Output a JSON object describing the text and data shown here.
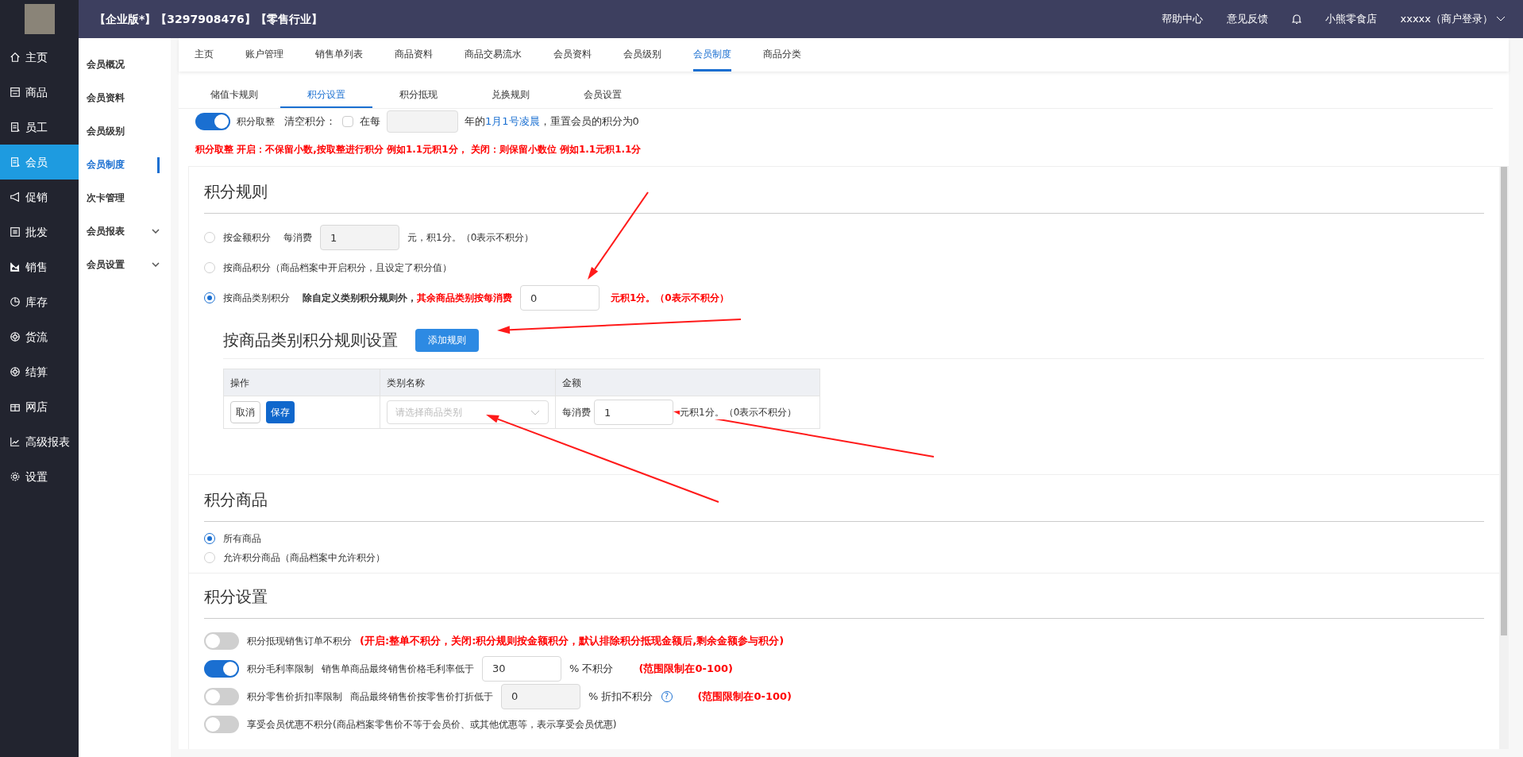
{
  "header": {
    "title": "【企业版*】【3297908476】【零售行业】",
    "links": [
      "帮助中心",
      "意见反馈"
    ],
    "store": "小熊零食店",
    "user": "xxxxx（商户登录）"
  },
  "sidebar": {
    "items": [
      {
        "label": "主页",
        "selected": false
      },
      {
        "label": "商品",
        "selected": false
      },
      {
        "label": "员工",
        "selected": false
      },
      {
        "label": "会员",
        "selected": true
      },
      {
        "label": "促销",
        "selected": false
      },
      {
        "label": "批发",
        "selected": false
      },
      {
        "label": "销售",
        "selected": false
      },
      {
        "label": "库存",
        "selected": false
      },
      {
        "label": "货流",
        "selected": false
      },
      {
        "label": "结算",
        "selected": false
      },
      {
        "label": "网店",
        "selected": false
      },
      {
        "label": "高级报表",
        "selected": false
      },
      {
        "label": "设置",
        "selected": false
      }
    ]
  },
  "submenu": [
    {
      "label": "会员概况",
      "selected": false,
      "expandable": false
    },
    {
      "label": "会员资料",
      "selected": false,
      "expandable": false
    },
    {
      "label": "会员级别",
      "selected": false,
      "expandable": false
    },
    {
      "label": "会员制度",
      "selected": true,
      "expandable": false
    },
    {
      "label": "次卡管理",
      "selected": false,
      "expandable": false
    },
    {
      "label": "会员报表",
      "selected": false,
      "expandable": true
    },
    {
      "label": "会员设置",
      "selected": false,
      "expandable": true
    }
  ],
  "top_tabs": [
    {
      "label": "主页",
      "selected": false
    },
    {
      "label": "账户管理",
      "selected": false
    },
    {
      "label": "销售单列表",
      "selected": false
    },
    {
      "label": "商品资料",
      "selected": false
    },
    {
      "label": "商品交易流水",
      "selected": false
    },
    {
      "label": "会员资料",
      "selected": false
    },
    {
      "label": "会员级别",
      "selected": false
    },
    {
      "label": "会员制度",
      "selected": true
    },
    {
      "label": "商品分类",
      "selected": false
    }
  ],
  "sub_tabs": [
    {
      "label": "储值卡规则",
      "selected": false
    },
    {
      "label": "积分设置",
      "selected": true
    },
    {
      "label": "积分抵现",
      "selected": false
    },
    {
      "label": "兑换规则",
      "selected": false
    },
    {
      "label": "会员设置",
      "selected": false
    }
  ],
  "rounding": {
    "on": true,
    "label": "积分取整",
    "clear_label": "清空积分：",
    "clear_checked": false,
    "every": "在每",
    "year_text": "年的",
    "date_link": "1月1号凌晨",
    "reset_text": "，重置会员的积分为0",
    "note": "积分取整 开启：不保留小数,按取整进行积分 例如1.1元积1分， 关闭：则保留小数位 例如1.1元积1.1分"
  },
  "rules": {
    "title": "积分规则",
    "options": [
      {
        "kind": "amount",
        "selected": false,
        "label": "按金额积分",
        "prefix": "每消费",
        "value": "1",
        "suffix": "元，积1分。（0表示不积分）"
      },
      {
        "kind": "product",
        "selected": false,
        "label": "按商品积分（商品档案中开启积分，且设定了积分值）"
      },
      {
        "kind": "category",
        "selected": true,
        "label": "按商品类别积分",
        "bold_text": "除自定义类别积分规则外，",
        "red_text": "其余商品类别按每消费",
        "value": "0",
        "suffix": "元积1分。（0表示不积分）"
      }
    ],
    "category_title": "按商品类别积分规则设置",
    "add_button": "添加规则",
    "columns": [
      "操作",
      "类别名称",
      "金额"
    ],
    "row": {
      "cancel": "取消",
      "save": "保存",
      "select_placeholder": "请选择商品类别",
      "prefix": "每消费",
      "value": "1",
      "suffix": "元积1分。（0表示不积分）"
    }
  },
  "products": {
    "title": "积分商品",
    "options": [
      {
        "label": "所有商品",
        "selected": true
      },
      {
        "label": "允许积分商品（商品档案中允许积分）",
        "selected": false
      }
    ]
  },
  "settings": {
    "title": "积分设置",
    "items": [
      {
        "kind": "note",
        "on": false,
        "label": "积分抵现销售订单不积分",
        "note": "(开启:整单不积分，关闭:积分规则按金额积分，默认排除积分抵现金额后,剩余金额参与积分)"
      },
      {
        "kind": "input",
        "on": true,
        "label": "积分毛利率限制",
        "desc": "销售单商品最终销售价格毛利率低于",
        "value": "30",
        "disabled": false,
        "suffix": "% 不积分",
        "note": "(范围限制在0-100)"
      },
      {
        "kind": "input",
        "on": false,
        "label": "积分零售价折扣率限制",
        "desc": "商品最终销售价按零售价打折低于",
        "value": "0",
        "disabled": true,
        "suffix": "% 折扣不积分",
        "help_mark": "?",
        "note": "(范围限制在0-100)"
      },
      {
        "kind": "plain",
        "on": false,
        "label": "享受会员优惠不积分(商品档案零售价不等于会员价、或其他优惠等，表示享受会员优惠)"
      }
    ]
  }
}
